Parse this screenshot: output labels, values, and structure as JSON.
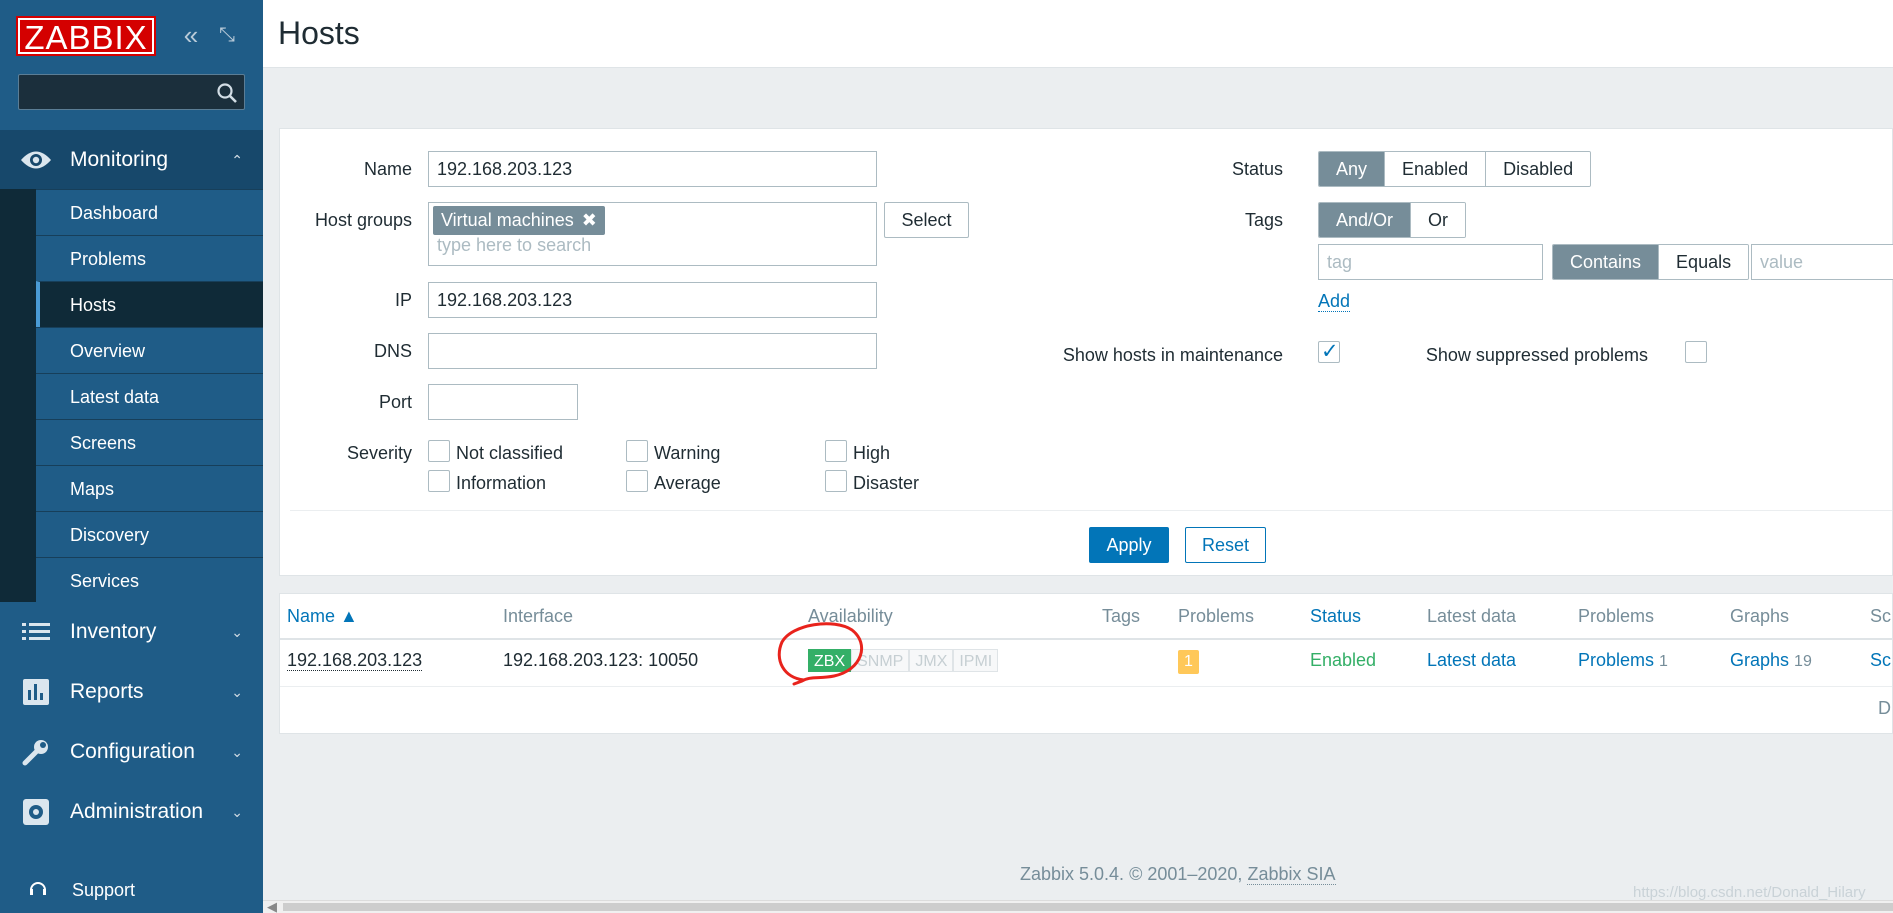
{
  "app": {
    "logo_text": "ZABBIX",
    "page_title": "Hosts"
  },
  "sidebar": {
    "search_placeholder": "",
    "sections": [
      {
        "label": "Monitoring",
        "expanded": true
      },
      {
        "label": "Inventory"
      },
      {
        "label": "Reports"
      },
      {
        "label": "Configuration"
      },
      {
        "label": "Administration"
      }
    ],
    "monitoring_items": [
      {
        "label": "Dashboard"
      },
      {
        "label": "Problems"
      },
      {
        "label": "Hosts",
        "active": true
      },
      {
        "label": "Overview"
      },
      {
        "label": "Latest data"
      },
      {
        "label": "Screens"
      },
      {
        "label": "Maps"
      },
      {
        "label": "Discovery"
      },
      {
        "label": "Services"
      }
    ],
    "support_label": "Support"
  },
  "filter": {
    "name_label": "Name",
    "name_value": "192.168.203.123",
    "host_groups_label": "Host groups",
    "host_group_chip": "Virtual machines",
    "host_groups_placeholder": "type here to search",
    "select_label": "Select",
    "ip_label": "IP",
    "ip_value": "192.168.203.123",
    "dns_label": "DNS",
    "dns_value": "",
    "port_label": "Port",
    "port_value": "",
    "severity_label": "Severity",
    "severities": [
      {
        "label": "Not classified",
        "checked": false
      },
      {
        "label": "Information",
        "checked": false
      },
      {
        "label": "Warning",
        "checked": false
      },
      {
        "label": "Average",
        "checked": false
      },
      {
        "label": "High",
        "checked": false
      },
      {
        "label": "Disaster",
        "checked": false
      }
    ],
    "status_label": "Status",
    "status_options": [
      "Any",
      "Enabled",
      "Disabled"
    ],
    "status_selected": "Any",
    "tags_label": "Tags",
    "tags_mode_options": [
      "And/Or",
      "Or"
    ],
    "tags_mode_selected": "And/Or",
    "tag_placeholder": "tag",
    "tag_operator_options": [
      "Contains",
      "Equals"
    ],
    "tag_operator_selected": "Contains",
    "value_placeholder": "value",
    "add_label": "Add",
    "show_maintenance_label": "Show hosts in maintenance",
    "show_maintenance_checked": true,
    "show_suppressed_label": "Show suppressed problems",
    "show_suppressed_checked": false,
    "apply_label": "Apply",
    "reset_label": "Reset"
  },
  "table": {
    "columns": [
      "Name ▲",
      "Interface",
      "Availability",
      "Tags",
      "Problems",
      "Status",
      "Latest data",
      "Problems",
      "Graphs",
      "Sc"
    ],
    "rows": [
      {
        "name": "192.168.203.123",
        "interface": "192.168.203.123: 10050",
        "availability": [
          "ZBX",
          "SNMP",
          "JMX",
          "IPMI"
        ],
        "problems_count": "1",
        "status": "Enabled",
        "latest_data": "Latest data",
        "problems_link": "Problems",
        "problems_link_count": "1",
        "graphs_link": "Graphs",
        "graphs_count": "19",
        "screens_link": "Sc"
      }
    ],
    "footer_cut_text": "D"
  },
  "footer": {
    "text": "Zabbix 5.0.4. © 2001–2020,",
    "link": "Zabbix SIA"
  },
  "watermark": "https://blog.csdn.net/Donald_Hilary"
}
